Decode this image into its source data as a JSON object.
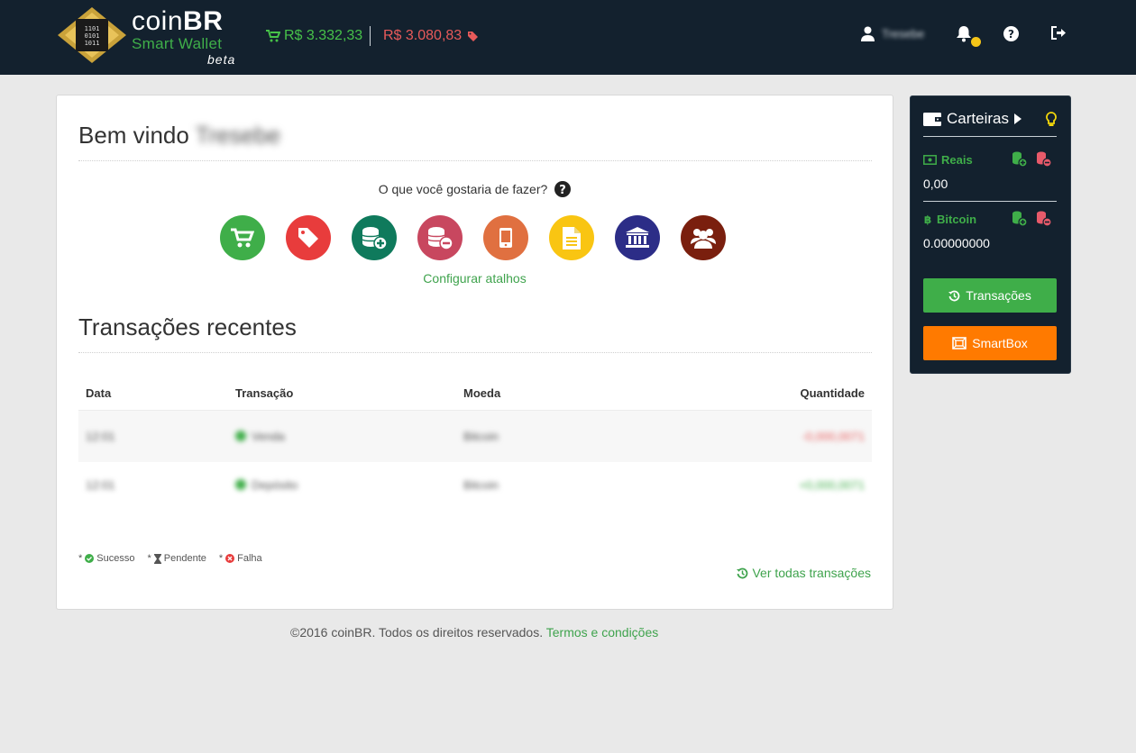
{
  "header": {
    "brand_prefix": "coin",
    "brand_suffix": "BR",
    "brand_sub": "Smart Wallet",
    "brand_beta": "beta",
    "buy_price": "R$ 3.332,33",
    "sell_price": "R$ 3.080,83",
    "user_name": "Tresebe",
    "colors": {
      "background": "#13212e",
      "buy": "#47c249",
      "sell": "#e85a5a",
      "notification": "#f5c518"
    }
  },
  "main": {
    "welcome": "Bem vindo",
    "welcome_user": "Tresebe",
    "question": "O que você gostaria de fazer?",
    "shortcuts": [
      {
        "icon": "cart-icon",
        "color": "#3fae49"
      },
      {
        "icon": "tag-icon",
        "color": "#e83c3c"
      },
      {
        "icon": "coins-add-icon",
        "color": "#0f7a5c"
      },
      {
        "icon": "coins-remove-icon",
        "color": "#c8475f"
      },
      {
        "icon": "mobile-icon",
        "color": "#e07040"
      },
      {
        "icon": "document-icon",
        "color": "#f9c512"
      },
      {
        "icon": "bank-icon",
        "color": "#2c2d87"
      },
      {
        "icon": "group-icon",
        "color": "#7a1f0e"
      }
    ],
    "configure_shortcuts": "Configurar atalhos",
    "recent_title": "Transações recentes",
    "table": {
      "columns": [
        "Data",
        "Transação",
        "Moeda",
        "Quantidade"
      ],
      "rows": [
        {
          "date": "12:01",
          "transaction": "Venda",
          "currency": "Bitcoin",
          "amount": "-0,000,0071",
          "amount_color": "#e85a5a"
        },
        {
          "date": "12:01",
          "transaction": "Depósito",
          "currency": "Bitcoin",
          "amount": "+0,000,0071",
          "amount_color": "#3fae49"
        }
      ]
    },
    "legend": {
      "success": "Sucesso",
      "pending": "Pendente",
      "failure": "Falha"
    },
    "see_all": "Ver todas transações"
  },
  "footer": {
    "copyright": "©2016 coinBR. Todos os direitos reservados.",
    "terms": "Termos e condições"
  },
  "sidebar": {
    "title": "Carteiras",
    "wallets": [
      {
        "name": "Reais",
        "balance": "0,00"
      },
      {
        "name": "Bitcoin",
        "balance": "0.00000000"
      }
    ],
    "transactions_button": "Transações",
    "smartbox_button": "SmartBox"
  }
}
